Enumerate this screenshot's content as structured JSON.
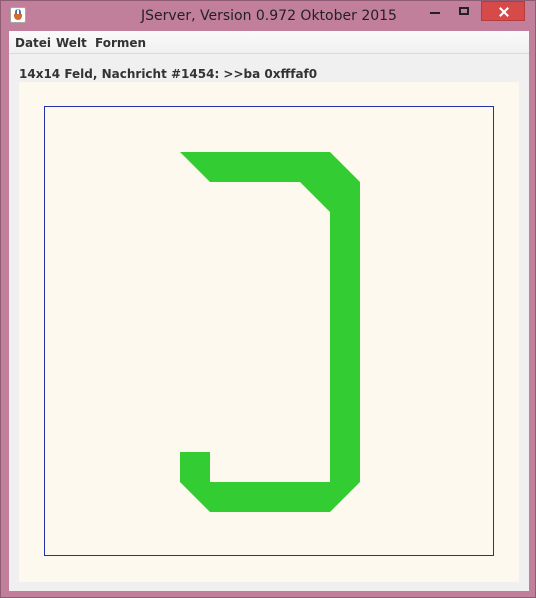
{
  "window": {
    "title": "JServer, Version 0.972 Oktober 2015",
    "icon": "java-icon",
    "controls": {
      "minimize": "minimize-icon",
      "maximize": "maximize-icon",
      "close": "close-icon"
    },
    "frame_color": "#c27f9b",
    "close_button_color": "#d64a4a"
  },
  "menubar": {
    "items": [
      {
        "label": "Datei"
      },
      {
        "label": "Welt"
      },
      {
        "label": "Formen"
      }
    ]
  },
  "status": {
    "message": "14x14 Feld, Nachricht #1454: >>ba 0xfffaf0"
  },
  "canvas": {
    "background": "#fdf9ee",
    "border_color": "#2231a8",
    "shape_color": "#33cc33",
    "shape_name": "green-bracket-shape"
  }
}
